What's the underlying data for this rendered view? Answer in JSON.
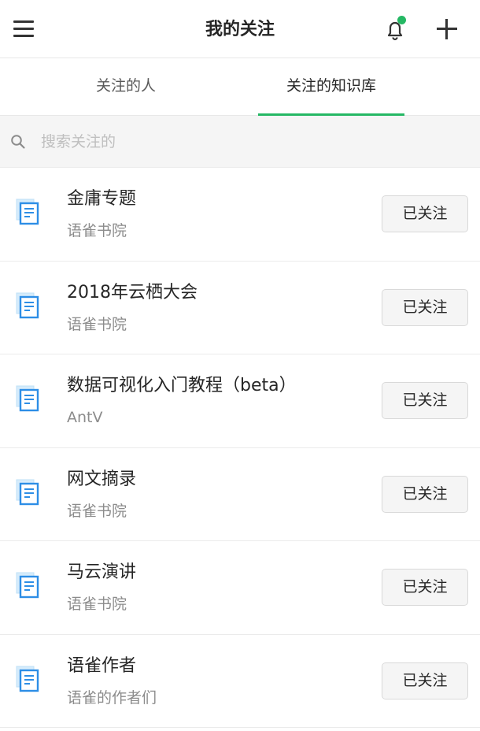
{
  "header": {
    "title": "我的关注",
    "menu_icon": "hamburger-menu-icon",
    "bell_icon": "bell-icon",
    "add_icon": "plus-icon",
    "notification_dot_color": "#25b864"
  },
  "tabs": [
    {
      "label": "关注的人",
      "active": false
    },
    {
      "label": "关注的知识库",
      "active": true
    }
  ],
  "accent_color": "#25b864",
  "search": {
    "placeholder": "搜索关注的",
    "icon": "search-icon"
  },
  "items": [
    {
      "title": "金庸专题",
      "owner": "语雀书院",
      "button": "已关注",
      "icon": "book-icon"
    },
    {
      "title": "2018年云栖大会",
      "owner": "语雀书院",
      "button": "已关注",
      "icon": "book-icon"
    },
    {
      "title": "数据可视化入门教程（beta）",
      "owner": "AntV",
      "button": "已关注",
      "icon": "book-icon"
    },
    {
      "title": "网文摘录",
      "owner": "语雀书院",
      "button": "已关注",
      "icon": "book-icon"
    },
    {
      "title": "马云演讲",
      "owner": "语雀书院",
      "button": "已关注",
      "icon": "book-icon"
    },
    {
      "title": "语雀作者",
      "owner": "语雀的作者们",
      "button": "已关注",
      "icon": "book-icon"
    }
  ]
}
